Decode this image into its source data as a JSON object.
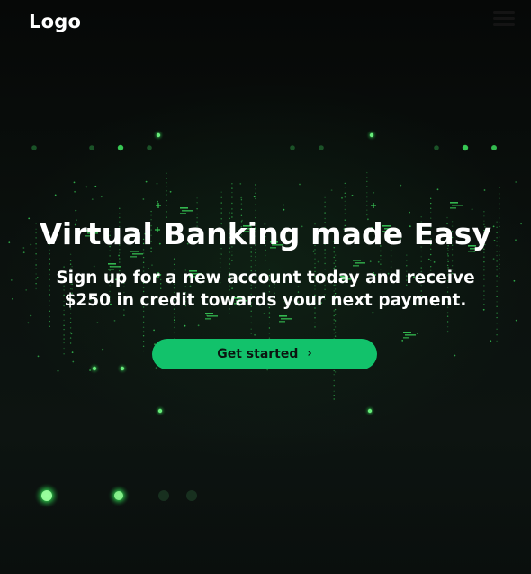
{
  "header": {
    "logo": "Logo",
    "menu_icon": "hamburger-menu-icon"
  },
  "hero": {
    "title": "Virtual Banking made Easy",
    "subtitle_line1": "Sign up for a new account today and receive",
    "subtitle_line2": "$250 in credit towards your next payment.",
    "cta_label": "Get started",
    "cta_icon": "chevron-right-icon"
  },
  "colors": {
    "background": "#0b0f0d",
    "accent": "#12c26b",
    "particle": "#3bd45a",
    "text": "#ffffff"
  }
}
